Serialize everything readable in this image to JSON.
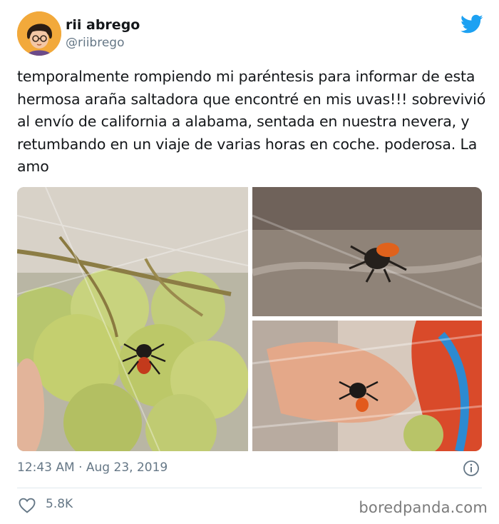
{
  "author": {
    "name": "rii abrego",
    "handle": "@riibrego"
  },
  "tweet": {
    "text": "temporalmente rompiendo mi paréntesis para informar de esta hermosa araña saltadora que encontré en mis uvas!!! sobrevivió al envío de california a alabama, sentada en nuestra nevera, y retumbando en un viaje de varias horas en coche. poderosa. La amo",
    "timestamp": "12:43 AM · Aug 23, 2019",
    "likes": "5.8K"
  },
  "icons": {
    "brand": "twitter-bird-icon",
    "info": "info-icon",
    "like": "heart-icon"
  },
  "colors": {
    "brand": "#1da1f2",
    "secondary_text": "#657786",
    "divider": "#e1e8ed"
  },
  "watermark": "boredpanda.com"
}
